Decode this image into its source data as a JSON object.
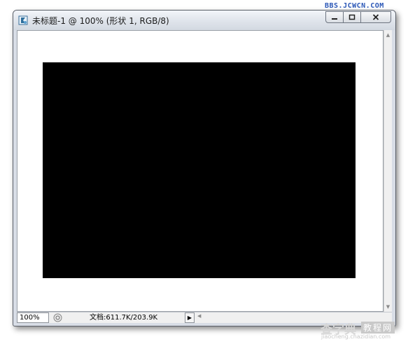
{
  "window": {
    "title": "未标题-1 @ 100% (形状 1, RGB/8)",
    "buttons": {
      "minimize_icon": "minimize-icon",
      "maximize_icon": "maximize-icon",
      "close_icon": "close-icon"
    }
  },
  "watermark": {
    "text": "BBS.JCWCN.COM"
  },
  "canvas": {
    "background_color": "#ffffff",
    "shape_color": "#000000"
  },
  "statusbar": {
    "zoom": "100%",
    "doc_info": "文档:611.7K/203.9K"
  },
  "site_logo": {
    "main": "查字典",
    "tag": "教程网",
    "url": "jiaocheng.chazidian.com"
  }
}
